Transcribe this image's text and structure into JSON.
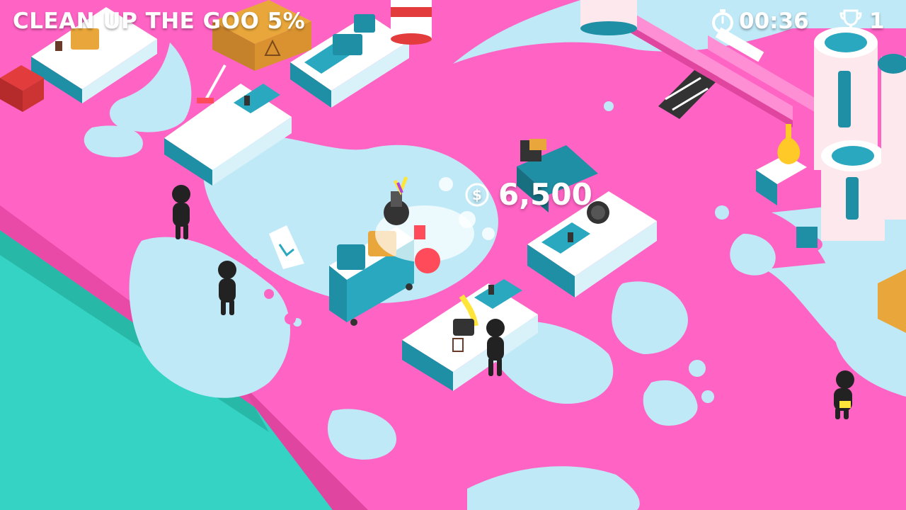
{
  "hud": {
    "objective": "CLEAN UP THE GOO 5%",
    "timer": "00:36",
    "trophy_count": "1",
    "timer_icon": "stopwatch-icon",
    "trophy_icon": "trophy-icon"
  },
  "reward": {
    "amount": "6,500",
    "icon": "dollar-coin-icon"
  },
  "colors": {
    "goo": "#ff63c4",
    "floor": "#bfe9f7",
    "water": "#35d3c3",
    "accent": "#1e8fa5"
  }
}
